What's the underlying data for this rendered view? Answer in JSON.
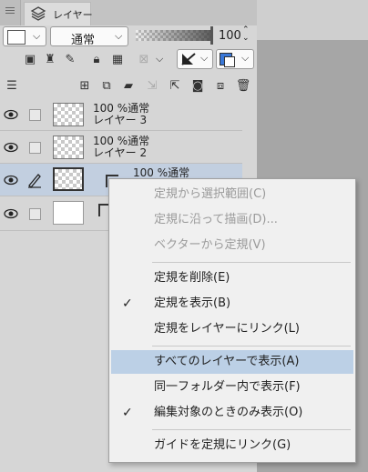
{
  "panel": {
    "tab_label": "レイヤー",
    "blend_mode": "通常",
    "opacity": "100"
  },
  "layers": [
    {
      "opacity_mode": "100 %通常",
      "name": "レイヤー 3",
      "selected": false
    },
    {
      "opacity_mode": "100 %通常",
      "name": "レイヤー 2",
      "selected": false
    },
    {
      "opacity_mode": "100 %通常",
      "name": "",
      "selected": true
    },
    {
      "opacity_mode": "",
      "name": "",
      "selected": false
    }
  ],
  "context_menu": {
    "items": [
      {
        "label": "定規から選択範囲(C)",
        "disabled": true,
        "checked": false
      },
      {
        "label": "定規に沿って描画(D)...",
        "disabled": true,
        "checked": false
      },
      {
        "label": "ベクターから定規(V)",
        "disabled": true,
        "checked": false
      },
      {
        "label": "定規を削除(E)",
        "disabled": false,
        "checked": false
      },
      {
        "label": "定規を表示(B)",
        "disabled": false,
        "checked": true
      },
      {
        "label": "定規をレイヤーにリンク(L)",
        "disabled": false,
        "checked": false
      },
      {
        "label": "すべてのレイヤーで表示(A)",
        "disabled": false,
        "checked": false,
        "highlighted": true
      },
      {
        "label": "同一フォルダー内で表示(F)",
        "disabled": false,
        "checked": false
      },
      {
        "label": "編集対象のときのみ表示(O)",
        "disabled": false,
        "checked": true
      },
      {
        "label": "ガイドを定規にリンク(G)",
        "disabled": false,
        "checked": false
      }
    ],
    "checkmark": "✓"
  },
  "colors": {
    "highlight": "#bcd0e6",
    "selected_row": "#c2cfe0"
  }
}
